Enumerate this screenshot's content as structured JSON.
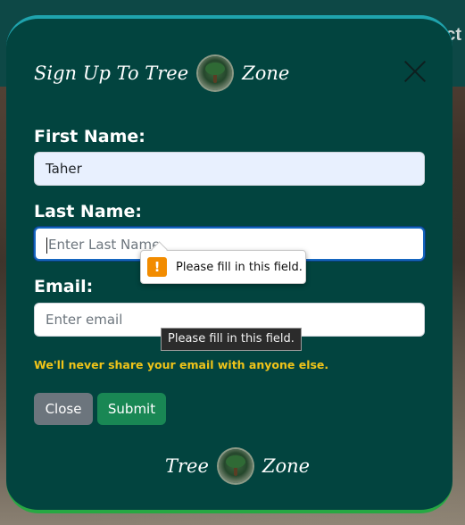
{
  "background": {
    "nav_text": "ct"
  },
  "modal": {
    "title_prefix": "Sign Up To Tree",
    "title_suffix": "Zone",
    "logo_icon": "tree-logo-icon",
    "close_icon": "close-icon"
  },
  "form": {
    "first_name": {
      "label": "First Name:",
      "value": "Taher"
    },
    "last_name": {
      "label": "Last Name:",
      "placeholder": "Enter Last Name"
    },
    "email": {
      "label": "Email:",
      "placeholder": "Enter email"
    },
    "help_text": "We'll never share your email with anyone else.",
    "validation_message": "Please fill in this field.",
    "validation_icon": "warning-icon",
    "tooltip_text": "Please fill in this field."
  },
  "buttons": {
    "close_label": "Close",
    "submit_label": "Submit"
  },
  "footer": {
    "brand_prefix": "Tree",
    "brand_suffix": "Zone"
  },
  "colors": {
    "modal_bg": "#02443f",
    "border_top": "#1fa3ad",
    "border_bottom": "#27a843",
    "help_text": "#f0c419",
    "close_button": "#6c757d",
    "submit_button": "#198754",
    "warning": "#f28c00"
  }
}
